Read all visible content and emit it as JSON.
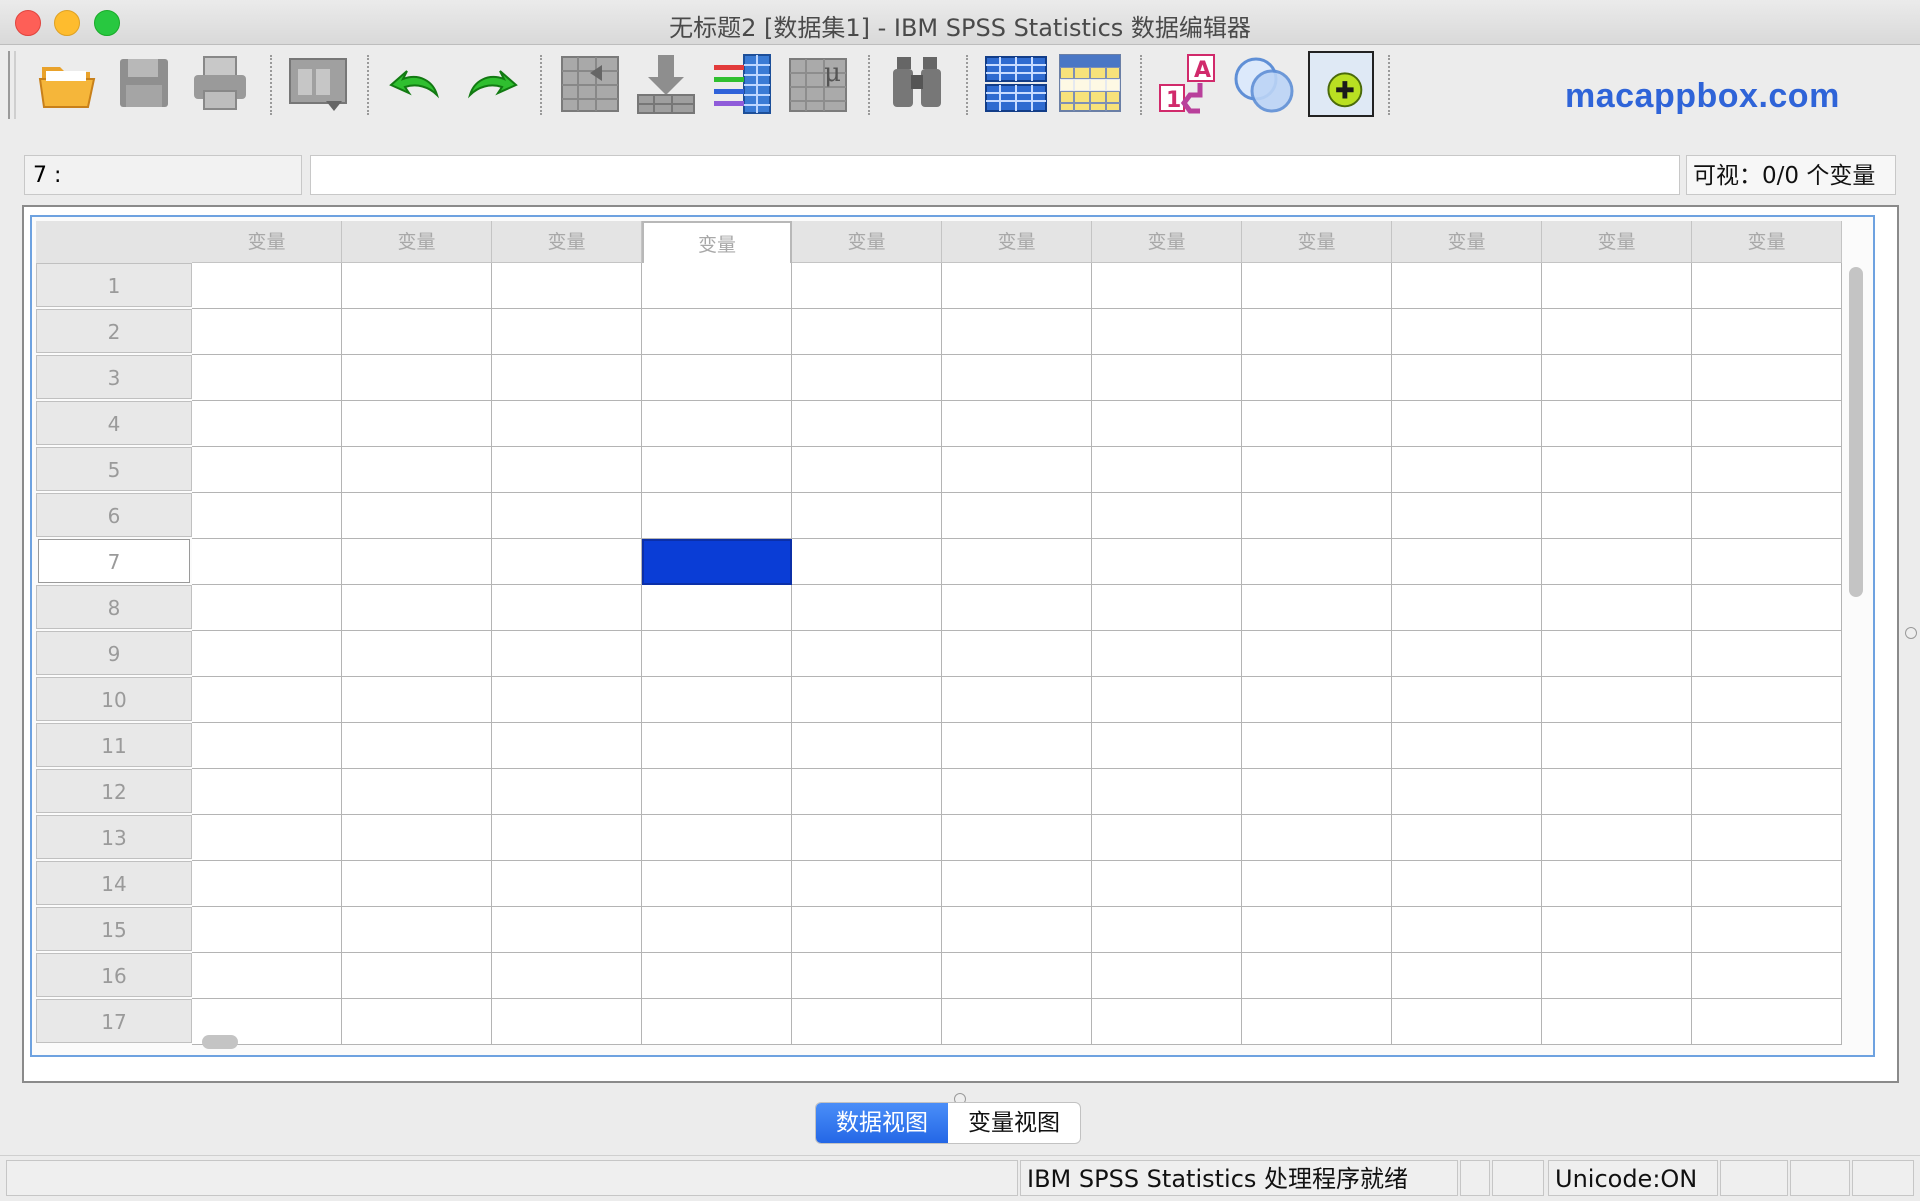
{
  "window": {
    "title": "无标题2 [数据集1] - IBM SPSS Statistics 数据编辑器"
  },
  "watermark": "macappbox.com",
  "toolbar": {
    "icons": [
      "open-folder-icon",
      "save-icon",
      "print-icon",
      "dialog-recall-icon",
      "undo-icon",
      "redo-icon",
      "goto-case-icon",
      "goto-variable-icon",
      "variables-icon",
      "descriptive-stats-icon",
      "find-icon",
      "split-file-icon",
      "select-cases-icon",
      "value-labels-icon",
      "use-variable-sets-icon",
      "add-icon"
    ]
  },
  "cell_info": {
    "ref": "7 :",
    "value": ""
  },
  "visible_vars": "可视：0/0 个变量",
  "grid": {
    "column_header": "变量",
    "columns": [
      "变量",
      "变量",
      "变量",
      "变量",
      "变量",
      "变量",
      "变量",
      "变量",
      "变量",
      "变量",
      "变量"
    ],
    "rows": [
      "1",
      "2",
      "3",
      "4",
      "5",
      "6",
      "7",
      "8",
      "9",
      "10",
      "11",
      "12",
      "13",
      "14",
      "15",
      "16",
      "17"
    ],
    "active_row": 7,
    "active_column": 4,
    "selected_color": "#0a3dd6"
  },
  "tabs": {
    "data_view": "数据视图",
    "variable_view": "变量视图",
    "active": "data_view"
  },
  "status": {
    "processor": "IBM SPSS Statistics 处理程序就绪",
    "unicode": "Unicode:ON"
  }
}
